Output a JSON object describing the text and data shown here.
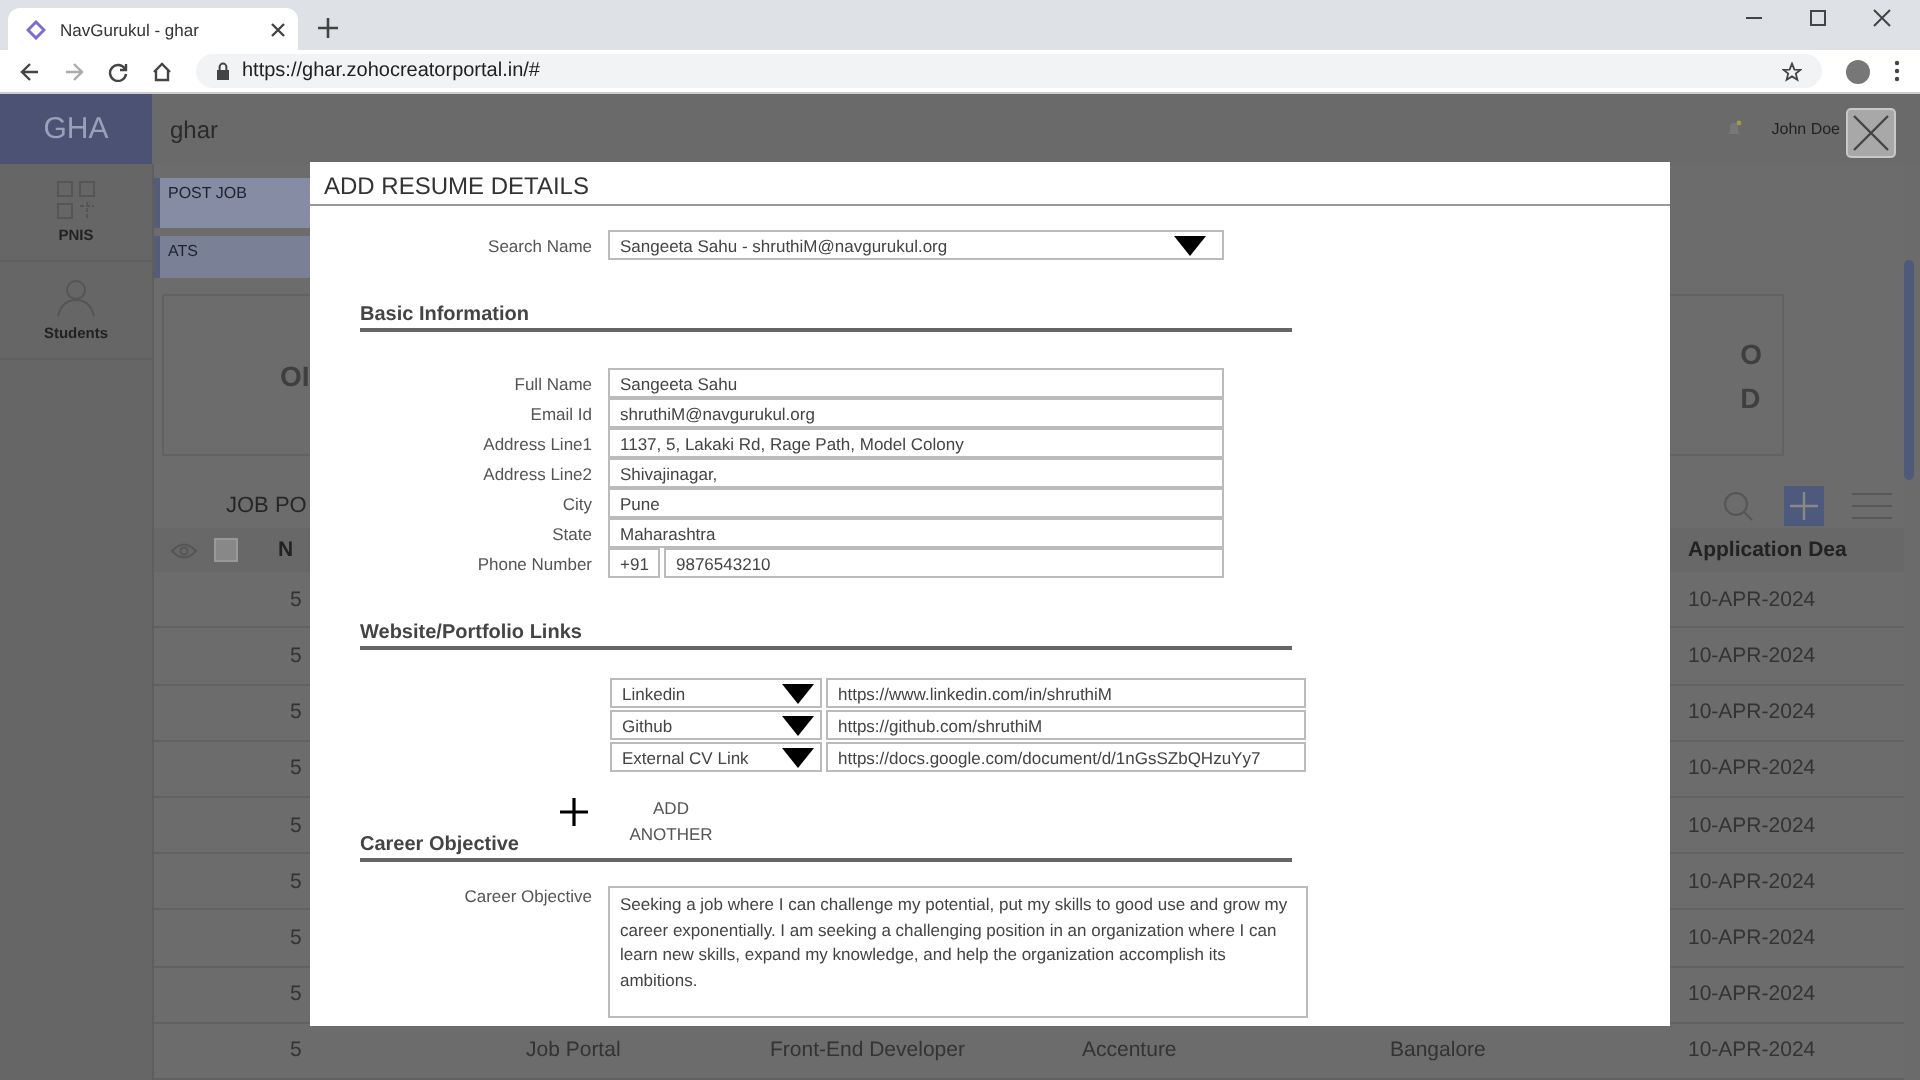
{
  "browser": {
    "tab_title": "NavGurukul - ghar",
    "url": "https://ghar.zohocreatorportal.in/#"
  },
  "app": {
    "logo": "GHA",
    "app_name": "ghar",
    "user": "John Doe",
    "sidebar": [
      {
        "label": "PNIS",
        "kind": "grid"
      },
      {
        "label": "Students",
        "kind": "person"
      }
    ],
    "tabs": [
      {
        "label": "POST JOB",
        "selected": true
      },
      {
        "label": "ATS",
        "selected": false
      }
    ],
    "card": {
      "left_text": "OI",
      "right_lines": [
        "O",
        "D"
      ]
    },
    "list_title": "JOB PO",
    "table": {
      "select_all_checked": false,
      "columns": [
        "N",
        "Application Dea"
      ],
      "rows": [
        {
          "number": "5",
          "cells": [],
          "deadline": "10-APR-2024"
        },
        {
          "number": "5",
          "cells": [],
          "deadline": "10-APR-2024"
        },
        {
          "number": "5",
          "cells": [],
          "deadline": "10-APR-2024"
        },
        {
          "number": "5",
          "cells": [],
          "deadline": "10-APR-2024"
        },
        {
          "number": "5",
          "cells": [],
          "deadline": "10-APR-2024"
        },
        {
          "number": "5",
          "cells": [],
          "deadline": "10-APR-2024"
        },
        {
          "number": "5",
          "cells": [],
          "deadline": "10-APR-2024"
        },
        {
          "number": "5",
          "cells": [],
          "deadline": "10-APR-2024"
        },
        {
          "number": "5",
          "cells": [
            "Job Portal",
            "Front-End Developer",
            "Accenture",
            "Bangalore"
          ],
          "deadline": "10-APR-2024"
        }
      ]
    }
  },
  "modal": {
    "title": "ADD RESUME DETAILS",
    "search": {
      "label": "Search Name",
      "value": "Sangeeta Sahu - shruthiM@navgurukul.org"
    },
    "sections": [
      {
        "kind": "fields",
        "heading": "Basic Information",
        "fields": [
          {
            "label": "Full Name",
            "value": "Sangeeta Sahu"
          },
          {
            "label": "Email Id",
            "value": "shruthiM@navgurukul.org"
          },
          {
            "label": "Address Line1",
            "value": "1137, 5, Lakaki Rd, Rage Path, Model Colony"
          },
          {
            "label": "Address Line2",
            "value": "Shivajinagar,"
          },
          {
            "label": "City",
            "value": "Pune"
          },
          {
            "label": "State",
            "value": "Maharashtra"
          },
          {
            "label": "Phone Number",
            "code": "+91",
            "value": "9876543210"
          }
        ]
      },
      {
        "kind": "links",
        "heading": "Website/Portfolio Links",
        "links": [
          {
            "type": "Linkedin",
            "url": "https://www.linkedin.com/in/shruthiM"
          },
          {
            "type": "Github",
            "url": "https://github.com/shruthiM"
          },
          {
            "type": "External CV Link",
            "url": "https://docs.google.com/document/d/1nGsSZbQHzuYy7"
          }
        ],
        "add_label": "ADD ANOTHER"
      },
      {
        "kind": "text",
        "heading": "Career Objective",
        "label": "Career Objective",
        "value": "Seeking a job where I can challenge my potential, put my skills to good use and grow my career exponentially. I am seeking a challenging position in an organization where I can learn new skills, expand my knowledge, and help the organization accomplish its ambitions."
      }
    ]
  }
}
